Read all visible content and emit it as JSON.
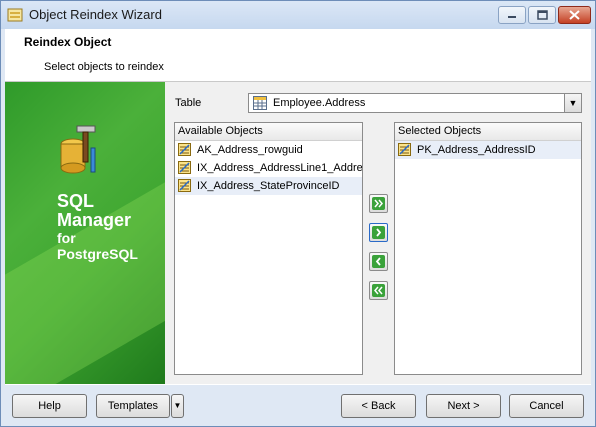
{
  "window": {
    "title": "Object Reindex Wizard"
  },
  "header": {
    "title": "Reindex Object",
    "subtitle": "Select objects to reindex"
  },
  "banner": {
    "line1": "SQL",
    "line2": "Manager",
    "line3": "for",
    "line4": "PostgreSQL"
  },
  "table": {
    "label": "Table",
    "value": "Employee.Address"
  },
  "available": {
    "header": "Available Objects",
    "items": [
      "AK_Address_rowguid",
      "IX_Address_AddressLine1_Addre",
      "IX_Address_StateProvinceID"
    ]
  },
  "selected": {
    "header": "Selected Objects",
    "items": [
      "PK_Address_AddressID"
    ]
  },
  "footer": {
    "help": "Help",
    "templates": "Templates",
    "back": "< Back",
    "next": "Next >",
    "cancel": "Cancel"
  },
  "icons": {
    "app": "wizard-app-icon",
    "table": "table-icon",
    "index": "index-icon",
    "move_all_right": "double-chevron-right-icon",
    "move_right": "chevron-right-icon",
    "move_left": "chevron-left-icon",
    "move_all_left": "double-chevron-left-icon"
  },
  "colors": {
    "banner_green": "#3fa631",
    "title_bg": "#c6d8ef",
    "close_red": "#c44024"
  }
}
